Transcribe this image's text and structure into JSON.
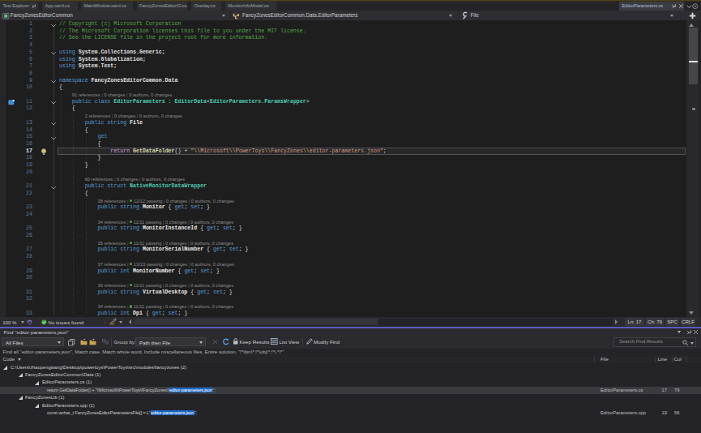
{
  "tabs": {
    "items": [
      {
        "label": "Test Explorer",
        "pinned": true
      },
      {
        "label": "App.xaml.cs"
      },
      {
        "label": "MainWindow.xaml.cs"
      },
      {
        "label": "FancyZonesEditorIO.cs"
      },
      {
        "label": "Overlay.cs"
      },
      {
        "label": "MonitorInfoModel.cs"
      }
    ],
    "preview_tab": {
      "label": "EditorParameters.cs"
    }
  },
  "navbar": {
    "project": "FancyZonesEditorCommon",
    "type": "FancyZonesEditorCommon.Data.EditorParameters",
    "member": "File"
  },
  "editor": {
    "rows": [
      {
        "n": 1,
        "f": 1,
        "t": [
          [
            "com",
            "// Copyright (c) Microsoft Corporation"
          ]
        ]
      },
      {
        "n": 2,
        "t": [
          [
            "com",
            "// The Microsoft Corporation licenses this file to you under the MIT license."
          ]
        ]
      },
      {
        "n": 3,
        "t": [
          [
            "com",
            "// See the LICENSE file in the project root for more information."
          ]
        ]
      },
      {
        "n": 4
      },
      {
        "n": 5,
        "f": 1,
        "t": [
          [
            "kw",
            "using"
          ],
          [
            "id",
            " System.Collections.Generic;"
          ]
        ]
      },
      {
        "n": 6,
        "t": [
          [
            "kw",
            "using"
          ],
          [
            "id",
            " System.Globalization;"
          ]
        ]
      },
      {
        "n": 7,
        "t": [
          [
            "kw",
            "using"
          ],
          [
            "id",
            " System.Text;"
          ]
        ]
      },
      {
        "n": 8
      },
      {
        "n": 9,
        "f": 1,
        "t": [
          [
            "kw",
            "namespace"
          ],
          [
            "id",
            " FancyZonesEditorCommon.Data"
          ]
        ]
      },
      {
        "n": 10,
        "t": [
          [
            "pun",
            "{"
          ]
        ]
      },
      {
        "lens": {
          "i": 4,
          "refs": "91 references",
          "rest": "0 changes | 0 authors, 0 changes"
        }
      },
      {
        "n": 11,
        "i": 4,
        "f": 1,
        "glyph": "bookmark",
        "t": [
          [
            "kw",
            "public class "
          ],
          [
            "typ",
            "EditorParameters"
          ],
          [
            "pun",
            " : "
          ],
          [
            "typ",
            "EditorData"
          ],
          [
            "pun",
            "<"
          ],
          [
            "typ",
            "EditorParameters.ParamsWrapper"
          ],
          [
            "pun",
            ">"
          ]
        ]
      },
      {
        "n": 12,
        "i": 4,
        "t": [
          [
            "pun",
            "{"
          ]
        ]
      },
      {
        "lens": {
          "i": 8,
          "refs": "2 references",
          "rest": "0 changes | 0 authors, 0 changes"
        }
      },
      {
        "n": 13,
        "i": 8,
        "f": 1,
        "t": [
          [
            "kw",
            "public string "
          ],
          [
            "prop",
            "File"
          ]
        ]
      },
      {
        "n": 14,
        "i": 8,
        "t": [
          [
            "pun",
            "{"
          ]
        ]
      },
      {
        "n": 15,
        "i": 12,
        "f": 1,
        "t": [
          [
            "kw",
            "get"
          ]
        ]
      },
      {
        "n": 16,
        "i": 12,
        "t": [
          [
            "pun",
            "{"
          ]
        ]
      },
      {
        "n": 17,
        "i": 16,
        "current": 1,
        "glyph": "bulb",
        "t": [
          [
            "ctl",
            "return "
          ],
          [
            "mth",
            "GetDataFolder"
          ],
          [
            "pun",
            "() + "
          ],
          [
            "str",
            "\""
          ],
          [
            "esc",
            "\\\\"
          ],
          [
            "str",
            "Microsoft"
          ],
          [
            "esc",
            "\\\\"
          ],
          [
            "str",
            "PowerToys"
          ],
          [
            "esc",
            "\\\\"
          ],
          [
            "str",
            "FancyZones"
          ],
          [
            "esc",
            "\\\\"
          ],
          [
            "str",
            "editor-parameters.json\""
          ],
          [
            "pun",
            ";"
          ]
        ]
      },
      {
        "n": 18,
        "i": 12,
        "t": [
          [
            "pun",
            "}"
          ]
        ]
      },
      {
        "n": 19,
        "i": 8,
        "t": [
          [
            "pun",
            "}"
          ]
        ]
      },
      {
        "n": 20
      },
      {
        "lens": {
          "i": 8,
          "refs": "60 references",
          "rest": "0 changes | 0 authors, 0 changes"
        }
      },
      {
        "n": 21,
        "i": 8,
        "f": 1,
        "t": [
          [
            "kw",
            "public struct "
          ],
          [
            "typ",
            "NativeMonitorDataWrapper"
          ]
        ]
      },
      {
        "n": 22,
        "i": 8,
        "t": [
          [
            "pun",
            "{"
          ]
        ]
      },
      {
        "lens": {
          "i": 12,
          "refs": "38 references",
          "pass": "12/12 passing",
          "rest": "0 changes | 0 authors, 0 changes"
        }
      },
      {
        "n": 23,
        "i": 12,
        "t": [
          [
            "kw",
            "public string "
          ],
          [
            "prop",
            "Monitor"
          ],
          [
            "pun",
            " { "
          ],
          [
            "kw",
            "get"
          ],
          [
            "pun",
            "; "
          ],
          [
            "kw",
            "set"
          ],
          [
            "pun",
            "; }"
          ]
        ]
      },
      {
        "n": 24
      },
      {
        "lens": {
          "i": 12,
          "refs": "34 references",
          "pass": "11/11 passing",
          "rest": "0 changes | 0 authors, 0 changes"
        }
      },
      {
        "n": 25,
        "i": 12,
        "t": [
          [
            "kw",
            "public string "
          ],
          [
            "prop",
            "MonitorInstanceId"
          ],
          [
            "pun",
            " { "
          ],
          [
            "kw",
            "get"
          ],
          [
            "pun",
            "; "
          ],
          [
            "kw",
            "set"
          ],
          [
            "pun",
            "; }"
          ]
        ]
      },
      {
        "n": 26
      },
      {
        "lens": {
          "i": 12,
          "refs": "35 references",
          "pass": "11/11 passing",
          "rest": "0 changes | 0 authors, 0 changes"
        }
      },
      {
        "n": 27,
        "i": 12,
        "t": [
          [
            "kw",
            "public string "
          ],
          [
            "prop",
            "MonitorSerialNumber"
          ],
          [
            "pun",
            " { "
          ],
          [
            "kw",
            "get"
          ],
          [
            "pun",
            "; "
          ],
          [
            "kw",
            "set"
          ],
          [
            "pun",
            "; }"
          ]
        ]
      },
      {
        "n": 28
      },
      {
        "lens": {
          "i": 12,
          "refs": "37 references",
          "pass": "13/13 passing",
          "rest": "0 changes | 0 authors, 0 changes"
        }
      },
      {
        "n": 29,
        "i": 12,
        "t": [
          [
            "kw",
            "public int "
          ],
          [
            "prop",
            "MonitorNumber"
          ],
          [
            "pun",
            " { "
          ],
          [
            "kw",
            "get"
          ],
          [
            "pun",
            "; "
          ],
          [
            "kw",
            "set"
          ],
          [
            "pun",
            "; }"
          ]
        ]
      },
      {
        "n": 30
      },
      {
        "lens": {
          "i": 12,
          "refs": "36 references",
          "pass": "11/11 passing",
          "rest": "0 changes | 0 authors, 0 changes"
        }
      },
      {
        "n": 31,
        "i": 12,
        "t": [
          [
            "kw",
            "public string "
          ],
          [
            "prop",
            "VirtualDesktop"
          ],
          [
            "pun",
            " { "
          ],
          [
            "kw",
            "get"
          ],
          [
            "pun",
            "; "
          ],
          [
            "kw",
            "set"
          ],
          [
            "pun",
            "; }"
          ]
        ]
      },
      {
        "n": 32
      },
      {
        "lens": {
          "i": 12,
          "refs": "34 references",
          "pass": "11/11 passing",
          "rest": "0 changes | 0 authors, 0 changes"
        }
      },
      {
        "n": 33,
        "i": 12,
        "t": [
          [
            "kw",
            "public int "
          ],
          [
            "prop",
            "Dpi"
          ],
          [
            "pun",
            " { "
          ],
          [
            "kw",
            "get"
          ],
          [
            "pun",
            "; "
          ],
          [
            "kw",
            "set"
          ],
          [
            "pun",
            "; }"
          ]
        ]
      }
    ]
  },
  "status_bar": {
    "zoom": "100 %",
    "health": "No issues found",
    "line": "Ln: 17",
    "char": "Ch: 79",
    "spaces": "SPC",
    "eol": "CRLF"
  },
  "find_panel": {
    "title": "Find \"editor-parameters.json\"",
    "toolbar": {
      "scope": "All Files",
      "group_by_label": "Group by:",
      "group_by": "Path then File",
      "keep_results": "Keep Results",
      "list_view": "List View",
      "modify_find": "Modify Find",
      "search_placeholder": "Search Find Results"
    },
    "summary": "Find all \"editor-parameters.json\", Match case, Match whole word, Include miscellaneous files, Entire solution, \"!*\\bin\\*;!*\\obj\\*;!*\\.*\\*\"",
    "columns": {
      "code": "Code",
      "file": "File",
      "line": "Line",
      "col": "Col"
    },
    "rows": [
      {
        "indent": 0,
        "text": "C:\\Users\\zhaopengwang\\Desktop\\powertoys\\PowerToys\\src\\modules\\fancyzones (2)"
      },
      {
        "indent": 1,
        "text": "FancyZonesEditorCommon\\Data (1)"
      },
      {
        "indent": 2,
        "text": "EditorParameters.cs (1)"
      },
      {
        "indent": 3,
        "snippet": {
          "before": "return GetDataFolder() + \"\\\\Microsoft\\\\PowerToys\\\\FancyZones\\\\",
          "match": "editor-parameters.json",
          "after": "\";"
        },
        "file": "EditorParameters.cs",
        "line": "17",
        "col": "79",
        "selected": true
      },
      {
        "indent": 1,
        "text": "FancyZonesLib (1)"
      },
      {
        "indent": 2,
        "text": "EditorParameters.cpp (1)"
      },
      {
        "indent": 3,
        "snippet": {
          "before": "const wchar_t FancyZonesEditorParametersFile[] = L\"",
          "match": "editor-parameters.json",
          "after": "\";"
        },
        "file": "EditorParameters.cpp",
        "line": "19",
        "col": "56"
      }
    ]
  },
  "colors": {
    "accent_splitter": "#5a5ac0",
    "match_highlight": "#1b66c4",
    "keyword": "#569cd6",
    "type": "#4ec9b0",
    "string": "#d69d85",
    "comment": "#57a64a"
  }
}
